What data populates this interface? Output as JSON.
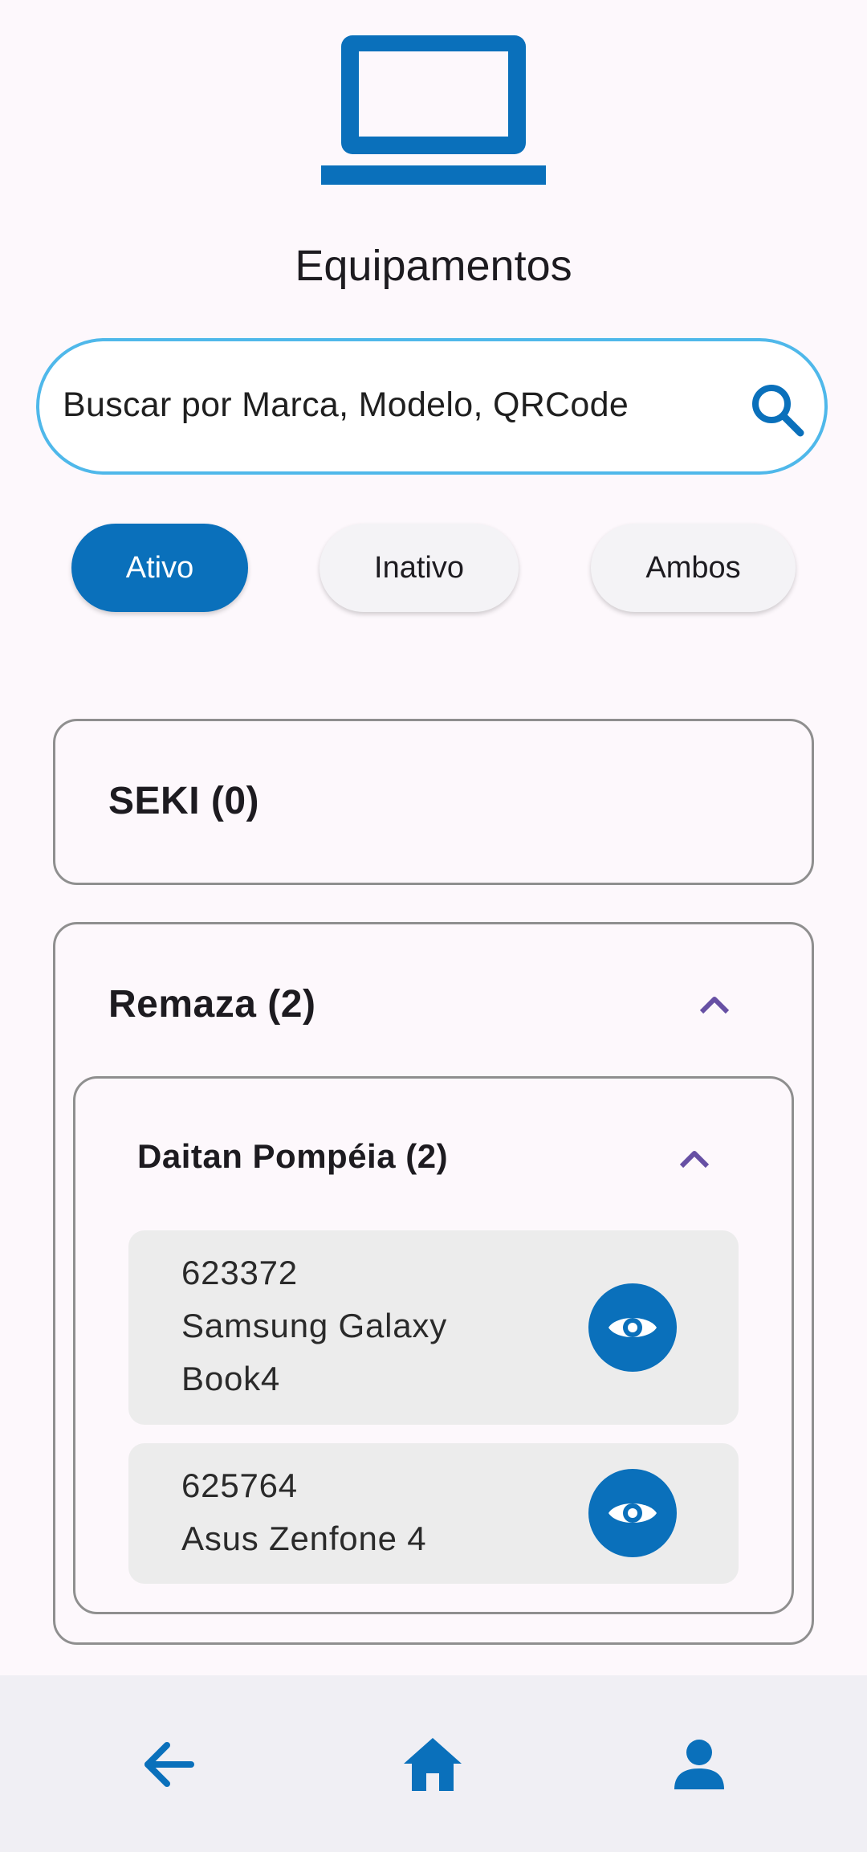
{
  "header": {
    "title": "Equipamentos",
    "icon": "laptop-icon"
  },
  "search": {
    "placeholder": "Buscar por Marca, Modelo, QRCode",
    "icon": "search-icon"
  },
  "filters": [
    {
      "label": "Ativo",
      "selected": true
    },
    {
      "label": "Inativo",
      "selected": false
    },
    {
      "label": "Ambos",
      "selected": false
    }
  ],
  "groups": [
    {
      "title": "SEKI (0)",
      "expanded": false
    },
    {
      "title": "Remaza (2)",
      "expanded": true,
      "subgroups": [
        {
          "title": "Daitan Pompéia (2)",
          "expanded": true,
          "items": [
            {
              "text": "623372\n Samsung Galaxy\nBook4",
              "action_icon": "eye-icon"
            },
            {
              "text": "625764\n Asus Zenfone 4",
              "action_icon": "eye-icon"
            }
          ]
        }
      ]
    }
  ],
  "bottom_nav": [
    {
      "icon": "back-arrow-icon"
    },
    {
      "icon": "home-icon"
    },
    {
      "icon": "person-icon"
    }
  ],
  "colors": {
    "primary": "#0a70bb",
    "search_border": "#4fb8ea",
    "chevron": "#6750a4",
    "item_bg": "#ececec",
    "bottom_bar": "#f0eff4"
  }
}
